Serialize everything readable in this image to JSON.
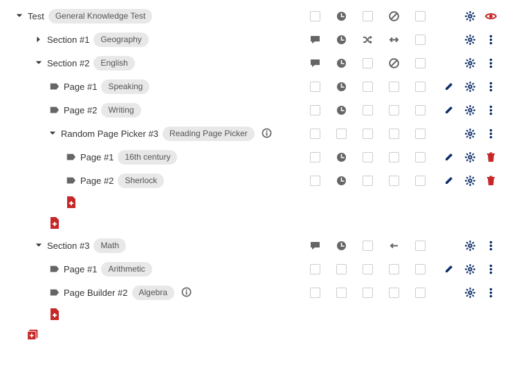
{
  "icons": {
    "caret_right": "caret-right-icon",
    "caret_down": "caret-down-icon",
    "page": "page-label-icon",
    "info": "info-icon",
    "chat": "chat-icon",
    "clock": "clock-icon",
    "shuffle": "shuffle-icon",
    "swap": "swap-icon",
    "back": "back-arrow-icon",
    "block": "block-icon",
    "gear": "gear-icon",
    "edit": "edit-icon",
    "more": "more-vert-icon",
    "eye": "eye-icon",
    "trash": "trash-icon",
    "add_page": "add-page-icon",
    "add_section": "add-section-icon"
  },
  "colors": {
    "navy": "#0d2e69",
    "red": "#c62828",
    "muted": "#666666",
    "chip_bg": "#e8e8e8"
  },
  "columns": [
    "chat_or_box",
    "timer",
    "shuffle",
    "nav",
    "extra"
  ],
  "tree": {
    "test": {
      "label": "Test",
      "chip": "General Knowledge Test",
      "cols": [
        "box",
        "clock",
        "box",
        "block",
        "box"
      ],
      "actions": [
        "gear",
        "eye_red"
      ]
    },
    "section1": {
      "label": "Section #1",
      "chip": "Geography",
      "collapsed": true,
      "cols": [
        "chat",
        "clock",
        "shuffle",
        "swap",
        "box"
      ],
      "actions": [
        "gear",
        "more"
      ]
    },
    "section2": {
      "label": "Section #2",
      "chip": "English",
      "collapsed": false,
      "cols": [
        "chat",
        "clock",
        "box",
        "block",
        "box"
      ],
      "actions": [
        "gear",
        "more"
      ],
      "pages": [
        {
          "label": "Page #1",
          "chip": "Speaking",
          "cols": [
            "box",
            "clock",
            "box",
            "box",
            "box"
          ],
          "actions": [
            "edit",
            "gear",
            "more"
          ]
        },
        {
          "label": "Page #2",
          "chip": "Writing",
          "cols": [
            "box",
            "clock",
            "box",
            "box",
            "box"
          ],
          "actions": [
            "edit",
            "gear",
            "more"
          ]
        }
      ],
      "picker": {
        "label": "Random Page Picker #3",
        "chip": "Reading Page Picker",
        "info": true,
        "cols": [
          "box",
          "box",
          "box",
          "box",
          "box"
        ],
        "actions": [
          "gear",
          "more"
        ],
        "pages": [
          {
            "label": "Page #1",
            "chip": "16th century",
            "cols": [
              "box",
              "clock",
              "box",
              "box",
              "box"
            ],
            "actions": [
              "edit",
              "gear",
              "trash"
            ]
          },
          {
            "label": "Page #2",
            "chip": "Sherlock",
            "cols": [
              "box",
              "clock",
              "box",
              "box",
              "box"
            ],
            "actions": [
              "edit",
              "gear",
              "trash"
            ]
          }
        ]
      }
    },
    "section3": {
      "label": "Section #3",
      "chip": "Math",
      "collapsed": false,
      "cols": [
        "chat",
        "clock",
        "box",
        "back",
        "box"
      ],
      "actions": [
        "gear",
        "more"
      ],
      "pages": [
        {
          "label": "Page #1",
          "chip": "Arithmetic",
          "cols": [
            "box",
            "box",
            "box",
            "box",
            "box"
          ],
          "actions": [
            "edit",
            "gear",
            "more"
          ]
        },
        {
          "label": "Page Builder #2",
          "chip": "Algebra",
          "info": true,
          "cols": [
            "box",
            "box",
            "box",
            "box",
            "box"
          ],
          "actions": [
            "gear",
            "more"
          ]
        }
      ]
    }
  }
}
